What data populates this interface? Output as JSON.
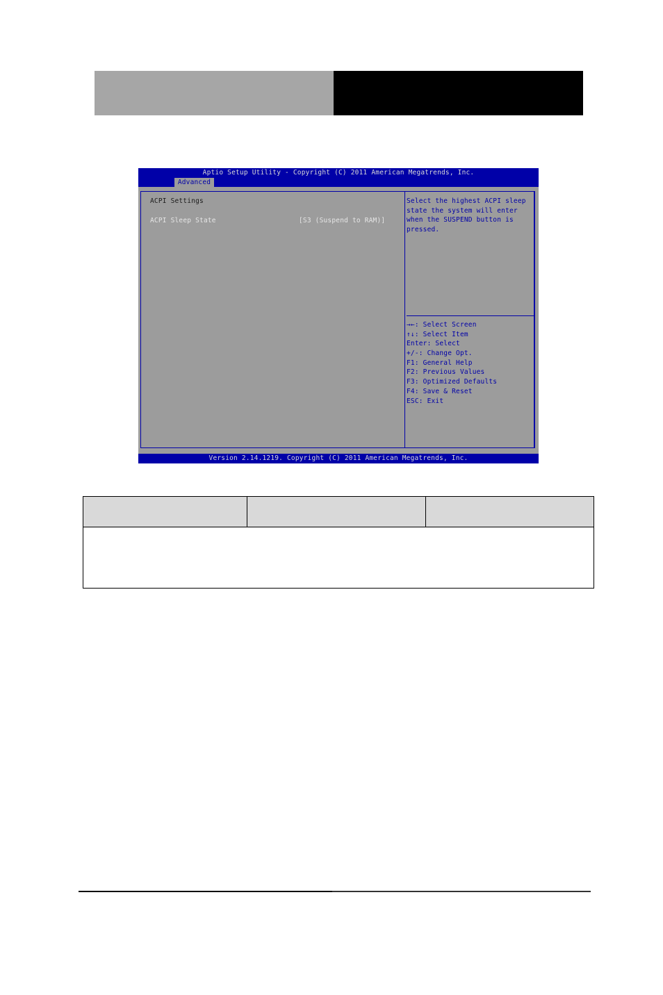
{
  "banner": {
    "left_color": "#a6a6a6",
    "right_color": "#000000"
  },
  "bios": {
    "title": "Aptio Setup Utility - Copyright (C) 2011 American Megatrends, Inc.",
    "active_tab": "Advanced",
    "section_title": "ACPI Settings",
    "items": [
      {
        "label": "ACPI Sleep State",
        "value": "[S3 (Suspend to RAM)]"
      }
    ],
    "help_text": "Select the highest ACPI sleep\nstate the system will enter\nwhen the SUSPEND button is\npressed.",
    "key_legend": [
      "→←: Select Screen",
      "↑↓: Select Item",
      "Enter: Select",
      "+/-: Change Opt.",
      "F1: General Help",
      "F2: Previous Values",
      "F3: Optimized Defaults",
      "F4: Save & Reset",
      "ESC: Exit"
    ],
    "footer": "Version 2.14.1219. Copyright (C) 2011 American Megatrends, Inc.",
    "colors": {
      "bar_blue": "#0000a8",
      "panel_gray": "#9c9c9c",
      "highlight_text": "#e6e6e6"
    }
  },
  "options_table": {
    "headers": [
      "",
      "",
      ""
    ],
    "rows": [
      [
        ""
      ]
    ]
  }
}
